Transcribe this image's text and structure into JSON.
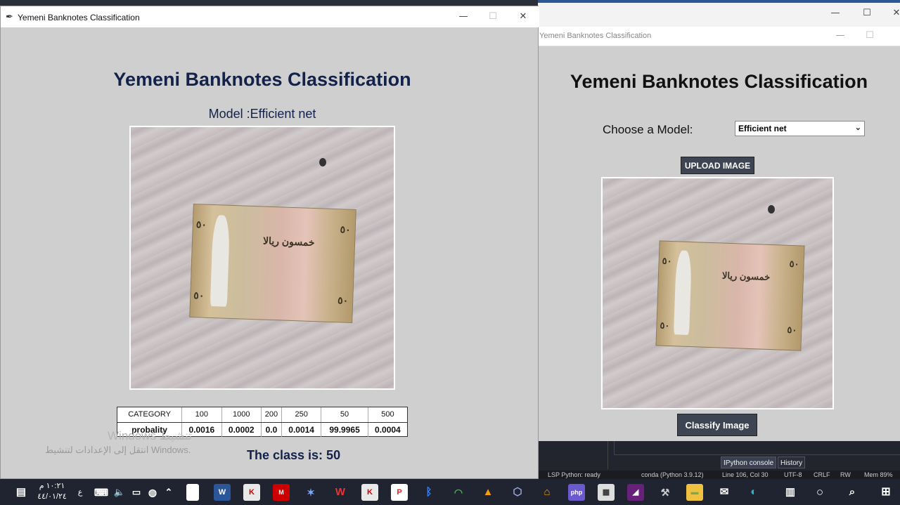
{
  "background_window": {
    "minimize": "—",
    "maximize": "☐",
    "close": "✕"
  },
  "right_window": {
    "title": "Yemeni Banknotes Classification",
    "heading": "Yemeni Banknotes Classification",
    "choose_label": "Choose a Model:",
    "model_selected": "Efficient net",
    "upload_button": "UPLOAD IMAGE",
    "classify_button": "Classify Image"
  },
  "ide": {
    "tabs": [
      "IPython console",
      "History"
    ],
    "status": [
      "LSP Python: ready",
      "conda (Python 3.9.12)",
      "Line 106, Col 30",
      "UTF-8",
      "CRLF",
      "RW",
      "Mem 89%"
    ]
  },
  "left_window": {
    "title": "Yemeni Banknotes Classification",
    "heading": "Yemeni Banknotes Classification",
    "model_line": "Model :Efficient net",
    "table": {
      "header": [
        "CATEGORY",
        "100",
        "1000",
        "200",
        "250",
        "50",
        "500"
      ],
      "row": [
        "probality",
        "0.0016",
        "0.0002",
        "0.0",
        "0.0014",
        "99.9965",
        "0.0004"
      ]
    },
    "result": "The class is: 50",
    "watermark_line1": "Windows تنشيط",
    "watermark_line2": "انتقل إلى الإعدادات لتنشيط Windows."
  },
  "taskbar": {
    "time": "١٠:٢١ م",
    "date": "٤٤/٠١/٢٤",
    "lang": "ع"
  },
  "banknote": {
    "denomination": "٥٠",
    "arabic_text": "خمسون ريالا"
  }
}
